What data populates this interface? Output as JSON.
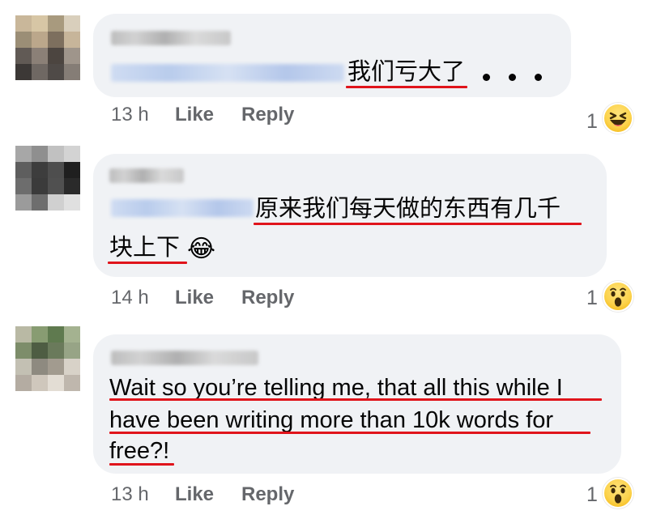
{
  "comments": [
    {
      "text": "我们亏大了",
      "trailing": "。。。",
      "time": "13 h",
      "like_label": "Like",
      "reply_label": "Reply",
      "reaction_count": "1",
      "reaction_icon": "laugh-squint-icon"
    },
    {
      "text_line1": "原来我们每天做的东西有几千",
      "text_line2": "块上下",
      "emoji": "😂",
      "time": "14 h",
      "like_label": "Like",
      "reply_label": "Reply",
      "reaction_count": "1",
      "reaction_icon": "wow-icon"
    },
    {
      "text_line1": "Wait so you’re telling me, that all this while I",
      "text_line2": "have been writing more than 10k words for",
      "text_line3": "free?!",
      "time": "13 h",
      "like_label": "Like",
      "reply_label": "Reply",
      "reaction_count": "1",
      "reaction_icon": "wow-icon"
    }
  ],
  "colors": {
    "bubble": "#f0f2f5",
    "underline": "#e0141b",
    "meta_text": "#65676b",
    "body_text": "#050505"
  }
}
